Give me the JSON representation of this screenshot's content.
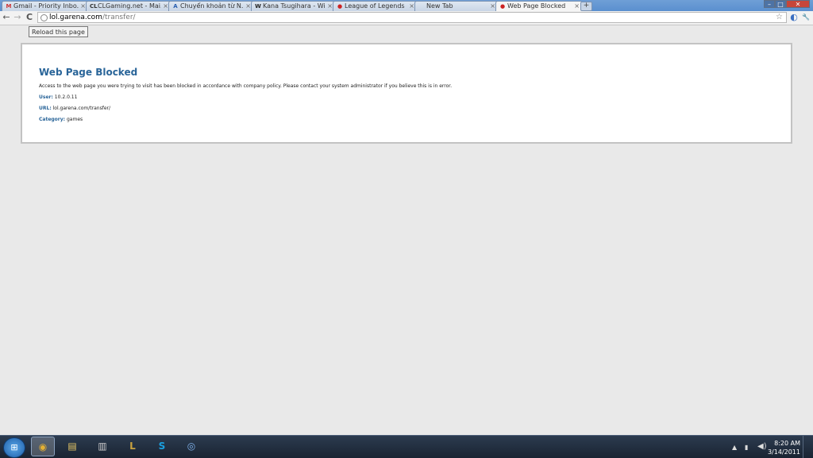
{
  "tabs": [
    {
      "title": "Gmail - Priority Inbo...",
      "icon": "gmail-icon",
      "glyph": "M",
      "color": "#c33"
    },
    {
      "title": "CLGaming.net - Mai...",
      "icon": "clgaming-icon",
      "glyph": "CL",
      "color": "#333"
    },
    {
      "title": "Chuyển khoản từ N...",
      "icon": "paypal-icon",
      "glyph": "A",
      "color": "#2a5fb0"
    },
    {
      "title": "Kana Tsugihara - Wi...",
      "icon": "wikipedia-icon",
      "glyph": "W",
      "color": "#222"
    },
    {
      "title": "League of Legends ...",
      "icon": "blocked-page-icon",
      "glyph": "●",
      "color": "#c22"
    },
    {
      "title": "New Tab",
      "icon": "",
      "glyph": "",
      "color": "#333"
    },
    {
      "title": "Web Page Blocked",
      "icon": "blocked-page-icon",
      "glyph": "●",
      "color": "#c22"
    }
  ],
  "tab_close_glyph": "×",
  "newtab_glyph": "+",
  "window_buttons": {
    "minimize": "–",
    "maximize": "□",
    "close": "✕"
  },
  "toolbar": {
    "back": "←",
    "forward": "→",
    "reload": "C",
    "url_host": "lol.garena.com",
    "url_path": "/transfer/",
    "star": "☆",
    "ext_icon": "◐",
    "wrench": "🔧"
  },
  "tooltip": "Reload this page",
  "block": {
    "title": "Web Page Blocked",
    "message": "Access to the web page you were trying to visit has been blocked in accordance with company policy. Please contact your system administrator if you believe this is in error.",
    "user_label": "User:",
    "user_value": "10.2.0.11",
    "url_label": "URL:",
    "url_value": "lol.garena.com/transfer/",
    "category_label": "Category:",
    "category_value": "games"
  },
  "taskbar": {
    "apps": [
      {
        "name": "chrome",
        "glyph": "◉",
        "color": "#e3b033",
        "active": true
      },
      {
        "name": "explorer",
        "glyph": "▤",
        "color": "#e7c766",
        "active": false
      },
      {
        "name": "app-stack",
        "glyph": "▥",
        "color": "#cccccc",
        "active": false
      },
      {
        "name": "league-of-legends",
        "glyph": "L",
        "color": "#c9a23f",
        "active": false
      },
      {
        "name": "skype",
        "glyph": "S",
        "color": "#1aa0e0",
        "active": false
      },
      {
        "name": "network",
        "glyph": "◎",
        "color": "#7fb2ec",
        "active": false
      }
    ],
    "time": "8:20 AM",
    "date": "3/14/2011"
  }
}
